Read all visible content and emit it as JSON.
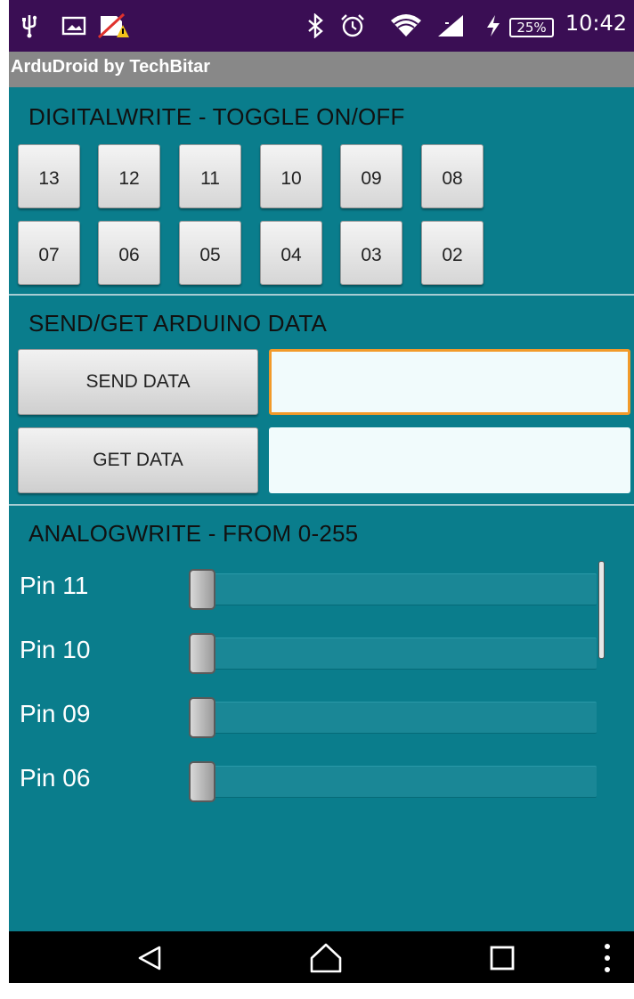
{
  "status_bar": {
    "time": "10:42",
    "battery_percent": "25%",
    "icons": [
      "usb-icon",
      "image-icon",
      "no-sim-warning-icon",
      "bluetooth-icon",
      "alarm-icon",
      "wifi-icon",
      "signal-icon",
      "charging-icon",
      "battery-icon"
    ]
  },
  "app": {
    "title": "ArduDroid by TechBitar"
  },
  "digital": {
    "title": "DIGITALWRITE - TOGGLE ON/OFF",
    "pins_row1": [
      "13",
      "12",
      "11",
      "10",
      "09",
      "08"
    ],
    "pins_row2": [
      "07",
      "06",
      "05",
      "04",
      "03",
      "02"
    ]
  },
  "data_section": {
    "title": "SEND/GET ARDUINO DATA",
    "send_label": "SEND DATA",
    "get_label": "GET DATA",
    "send_value": "",
    "get_value": ""
  },
  "analog": {
    "title": "ANALOGWRITE - FROM 0-255",
    "sliders": [
      {
        "label": "Pin 11",
        "value": 0
      },
      {
        "label": "Pin 10",
        "value": 0
      },
      {
        "label": "Pin 09",
        "value": 0
      },
      {
        "label": "Pin 06",
        "value": 0
      }
    ]
  },
  "nav_bar": {
    "icons": [
      "back-icon",
      "home-icon",
      "recents-icon",
      "menu-icon"
    ]
  },
  "colors": {
    "background": "#0a7d8c",
    "status_bar": "#3a0e54",
    "title_bar": "#888888",
    "focus_border": "#f29a2a"
  }
}
